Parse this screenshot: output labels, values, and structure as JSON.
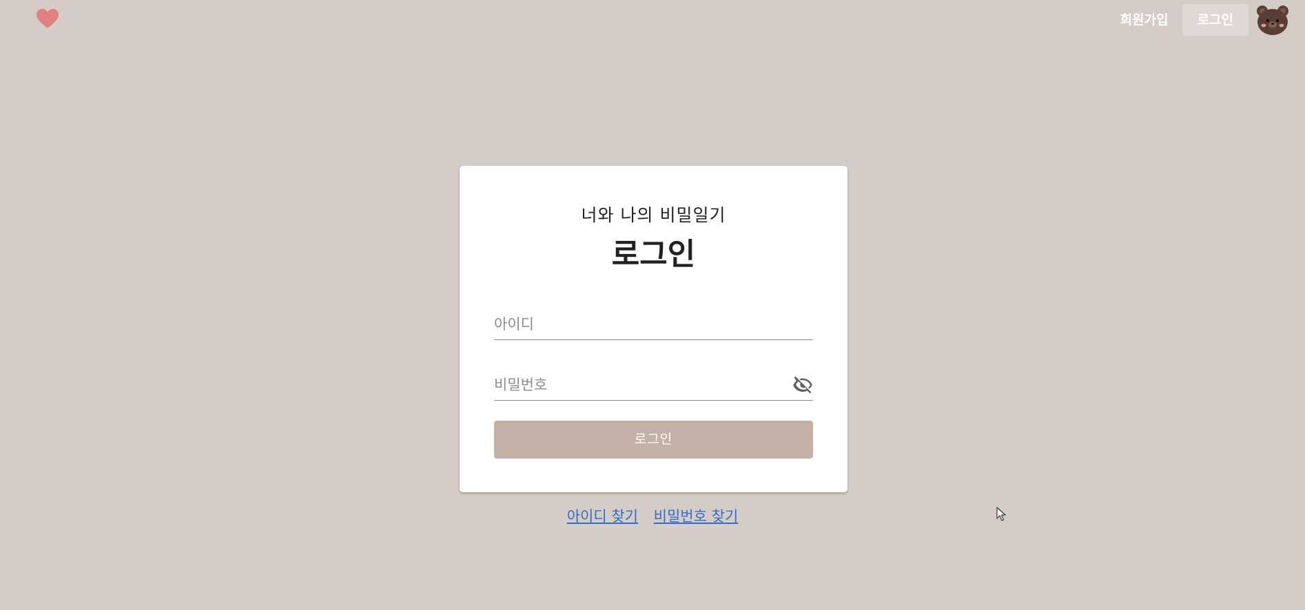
{
  "header": {
    "logo_icon": "heart-icon",
    "signup_label": "회원가입",
    "login_label": "로그인",
    "avatar_icon": "bear-avatar-icon"
  },
  "login_card": {
    "subtitle": "너와 나의 비밀일기",
    "title": "로그인",
    "id_placeholder": "아이디",
    "id_value": "",
    "password_placeholder": "비밀번호",
    "password_value": "",
    "toggle_icon": "eye-off-icon",
    "submit_label": "로그인"
  },
  "links": {
    "find_id": "아이디 찾기",
    "find_password": "비밀번호 찾기"
  },
  "colors": {
    "background": "#d6ccc7",
    "button": "#c4b1a5",
    "link": "#2f6fc7",
    "heart": "#e0817f"
  }
}
